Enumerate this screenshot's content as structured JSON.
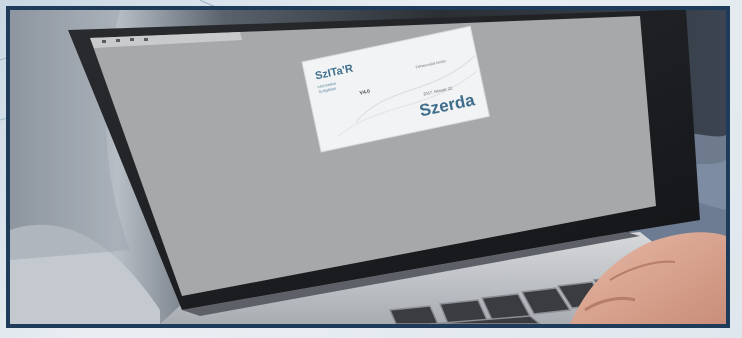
{
  "splash": {
    "logo": "SzITa'R",
    "logo_sub_1": "Informatikai",
    "logo_sub_2": "Szolgáltató",
    "version": "V4.0",
    "right_small": "Felhasználói felület",
    "date_line": "2017. február 22.",
    "day": "Szerda"
  },
  "colors": {
    "frame_border": "#1f3b5a",
    "screen_gray": "#a7a8a9",
    "splash_text": "#3f6e8c"
  }
}
